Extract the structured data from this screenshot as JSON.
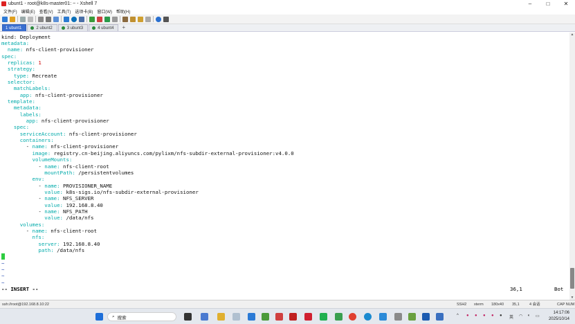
{
  "window": {
    "title": "ubunt1 - root@k8s-master01: ~ - Xshell 7",
    "controls": [
      "–",
      "□",
      "✕"
    ]
  },
  "menu": [
    "文件(F)",
    "编辑(E)",
    "查看(V)",
    "工具(T)",
    "选项卡(B)",
    "窗口(W)",
    "帮助(H)"
  ],
  "tabs": [
    {
      "label": "1 ubunt1",
      "active": true
    },
    {
      "label": "2 ubunt2",
      "active": false
    },
    {
      "label": "3 ubunt3",
      "active": false
    },
    {
      "label": "4 ubunt4",
      "active": false
    }
  ],
  "tab_add": "+",
  "terminal": {
    "lines": [
      {
        "indent": "",
        "key": "kind:",
        "val": " Deployment",
        "keycolor": "v"
      },
      {
        "indent": "",
        "key": "metadata:",
        "val": ""
      },
      {
        "indent": "  ",
        "key": "name:",
        "val": " nfs-client-provisioner"
      },
      {
        "indent": "",
        "key": "spec:",
        "val": ""
      },
      {
        "indent": "  ",
        "key": "replicas:",
        "val": " 1",
        "num": true
      },
      {
        "indent": "  ",
        "key": "strategy:",
        "val": ""
      },
      {
        "indent": "    ",
        "key": "type:",
        "val": " Recreate"
      },
      {
        "indent": "  ",
        "key": "selector:",
        "val": ""
      },
      {
        "indent": "    ",
        "key": "matchLabels:",
        "val": ""
      },
      {
        "indent": "      ",
        "key": "app:",
        "val": " nfs-client-provisioner"
      },
      {
        "indent": "  ",
        "key": "template:",
        "val": ""
      },
      {
        "indent": "    ",
        "key": "metadata:",
        "val": ""
      },
      {
        "indent": "      ",
        "key": "labels:",
        "val": ""
      },
      {
        "indent": "        ",
        "key": "app:",
        "val": " nfs-client-provisioner"
      },
      {
        "indent": "    ",
        "key": "spec:",
        "val": ""
      },
      {
        "indent": "      ",
        "key": "serviceAccount:",
        "val": " nfs-client-provisioner"
      },
      {
        "indent": "      ",
        "key": "containers:",
        "val": ""
      },
      {
        "indent": "        - ",
        "key": "name:",
        "val": " nfs-client-provisioner"
      },
      {
        "indent": "          ",
        "key": "image:",
        "val": " registry.cn-beijing.aliyuncs.com/pylixm/nfs-subdir-external-provisioner:v4.0.0"
      },
      {
        "indent": "          ",
        "key": "volumeMounts:",
        "val": ""
      },
      {
        "indent": "            - ",
        "key": "name:",
        "val": " nfs-client-root"
      },
      {
        "indent": "              ",
        "key": "mountPath:",
        "val": " /persistentvolumes"
      },
      {
        "indent": "          ",
        "key": "env:",
        "val": ""
      },
      {
        "indent": "            - ",
        "key": "name:",
        "val": " PROVISIONER_NAME"
      },
      {
        "indent": "              ",
        "key": "value:",
        "val": " k8s-sigs.io/nfs-subdir-external-provisioner"
      },
      {
        "indent": "            - ",
        "key": "name:",
        "val": " NFS_SERVER"
      },
      {
        "indent": "              ",
        "key": "value:",
        "val": " 192.168.8.40"
      },
      {
        "indent": "            - ",
        "key": "name:",
        "val": " NFS_PATH"
      },
      {
        "indent": "              ",
        "key": "value:",
        "val": " /data/nfs"
      },
      {
        "indent": "      ",
        "key": "volumes:",
        "val": ""
      },
      {
        "indent": "        - ",
        "key": "name:",
        "val": " nfs-client-root"
      },
      {
        "indent": "          ",
        "key": "nfs:",
        "val": ""
      },
      {
        "indent": "            ",
        "key": "server:",
        "val": " 192.168.8.40"
      },
      {
        "indent": "            ",
        "key": "path:",
        "val": " /data/nfs"
      }
    ],
    "tilde": "~",
    "mode": "-- INSERT --",
    "position": "36,1",
    "scroll": "Bot"
  },
  "statusbar": {
    "connection": "ssh://root@192.168.8.10:22",
    "protocol": "SSH2",
    "term": "xterm",
    "size": "180x40",
    "cursor": "35,1",
    "sessions": "4 会话",
    "caps": "CAP NUM"
  },
  "taskbar": {
    "search_placeholder": "搜索",
    "lang": "英",
    "time": "14:17:06",
    "date": "2025/10/14"
  },
  "colors": {
    "key": "#00aaaa",
    "number": "#cc0000",
    "tilde": "#2a4fb4",
    "cursor": "#2ecc40",
    "active_tab": "#3a6fd0"
  }
}
